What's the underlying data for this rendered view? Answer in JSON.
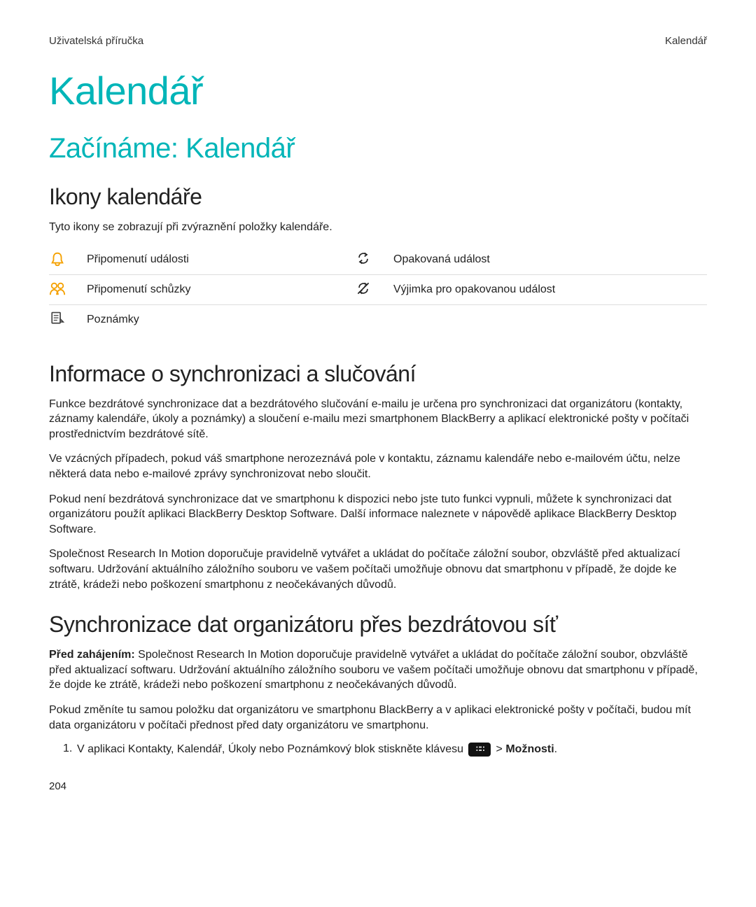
{
  "header": {
    "left": "Uživatelská příručka",
    "right": "Kalendář"
  },
  "title": "Kalendář",
  "section_title": "Začínáme: Kalendář",
  "icons_section": {
    "heading": "Ikony kalendáře",
    "intro": "Tyto ikony se zobrazují při zvýraznění položky kalendáře.",
    "rows": [
      {
        "icon1": "bell",
        "label1": "Připomenutí události",
        "icon2": "recur",
        "label2": "Opakovaná událost"
      },
      {
        "icon1": "people",
        "label1": "Připomenutí schůzky",
        "icon2": "recur-except",
        "label2": "Výjimka pro opakovanou událost"
      },
      {
        "icon1": "note",
        "label1": "Poznámky",
        "icon2": "",
        "label2": ""
      }
    ]
  },
  "sync_info": {
    "heading": "Informace o synchronizaci a slučování",
    "paras": [
      "Funkce bezdrátové synchronizace dat a bezdrátového slučování e-mailu je určena pro synchronizaci dat organizátoru (kontakty, záznamy kalendáře, úkoly a poznámky) a sloučení e-mailu mezi smartphonem BlackBerry a aplikací elektronické pošty v počítači prostřednictvím bezdrátové sítě.",
      "Ve vzácných případech, pokud váš smartphone nerozeznává pole v kontaktu, záznamu kalendáře nebo e-mailovém účtu, nelze některá data nebo e-mailové zprávy synchronizovat nebo sloučit.",
      "Pokud není bezdrátová synchronizace dat ve smartphonu k dispozici nebo jste tuto funkci vypnuli, můžete k synchronizaci dat organizátoru použít aplikaci BlackBerry Desktop Software. Další informace naleznete v nápovědě aplikace BlackBerry Desktop Software.",
      "Společnost Research In Motion doporučuje pravidelně vytvářet a ukládat do počítače záložní soubor, obzvláště před aktualizací softwaru. Udržování aktuálního záložního souboru ve vašem počítači umožňuje obnovu dat smartphonu v případě, že dojde ke ztrátě, krádeži nebo poškození smartphonu z neočekávaných důvodů."
    ]
  },
  "sync_wireless": {
    "heading": "Synchronizace dat organizátoru přes bezdrátovou síť",
    "before_label": "Před zahájením:",
    "before_text": " Společnost Research In Motion doporučuje pravidelně vytvářet a ukládat do počítače záložní soubor, obzvláště před aktualizací softwaru. Udržování aktuálního záložního souboru ve vašem počítači umožňuje obnovu dat smartphonu v případě, že dojde ke ztrátě, krádeži nebo poškození smartphonu z neočekávaných důvodů.",
    "para2": "Pokud změníte tu samou položku dat organizátoru ve smartphonu BlackBerry a v aplikaci elektronické pošty v počítači, budou mít data organizátoru v počítači přednost před daty organizátoru ve smartphonu.",
    "step1_num": "1.",
    "step1_pre": "V aplikaci Kontakty, Kalendář, Úkoly nebo Poznámkový blok stiskněte klávesu ",
    "step1_btn": "∷∷",
    "step1_sep": " > ",
    "step1_post": "Možnosti",
    "step1_end": "."
  },
  "page_number": "204"
}
